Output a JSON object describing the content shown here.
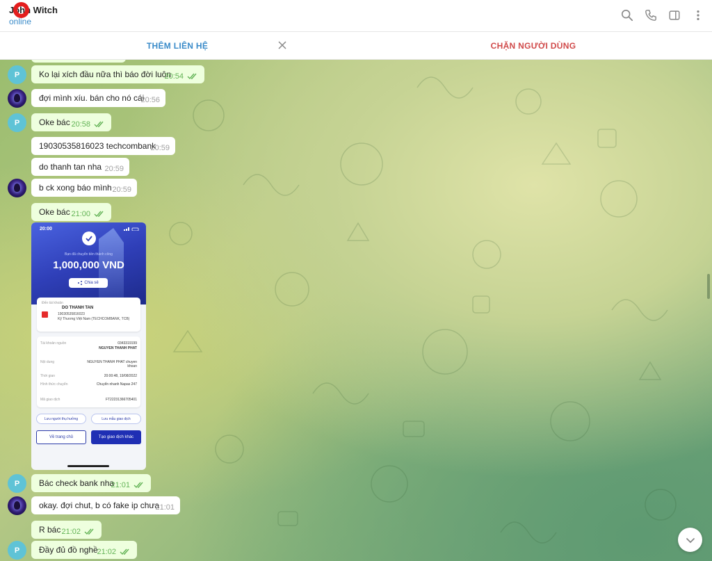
{
  "header": {
    "name": "John Witch",
    "status": "online",
    "icons": [
      "search-icon",
      "phone-icon",
      "sidebar-icon",
      "more-vertical-icon"
    ]
  },
  "actions": {
    "add_contact": "THÊM LIÊN HỆ",
    "block_user": "CHẶN NGƯỜI DÙNG"
  },
  "avatars": {
    "p_initial": "P"
  },
  "messages": [
    {
      "text": "Ko lại xích đầu nữa thì báo đời luôn",
      "time": "20:54"
    },
    {
      "text": "đợi mình xíu. bán cho nó cái",
      "time": "20:56"
    },
    {
      "text": "Oke bác",
      "time": "20:58"
    },
    {
      "text": "19030535816023 techcombank",
      "time": "20:59"
    },
    {
      "text": "do thanh tan nha",
      "time": "20:59"
    },
    {
      "text": "b ck xong báo mình",
      "time": "20:59"
    },
    {
      "text": "Oke bác",
      "time": "21:00"
    },
    {
      "text": "Bác check bank nha",
      "time": "21:01"
    },
    {
      "text": "okay. đợi chut, b có fake ip chưa",
      "time": "21:01"
    },
    {
      "text": "R bác",
      "time": "21:02"
    },
    {
      "text": "Đầy đủ đồ nghề",
      "time": "21:02"
    }
  ],
  "receipt": {
    "clock": "20:00",
    "subtitle": "Bạn đã chuyển tiền thành công",
    "amount": "1,000,000 VND",
    "share": "Chia sẻ",
    "to_account_label": "Đến tài khoản",
    "recipient_name": "DO THANH TAN",
    "recipient_account": "19030535816023",
    "recipient_bank": "Kỹ Thương Việt Nam (TECHCOMBANK, TCB)",
    "source_label": "Tài khoản nguồn",
    "source_account": "0343319199",
    "source_name": "NGUYEN THANH PHAT",
    "content_label": "Nội dung",
    "content_value": "NGUYEN THANH PHAT chuyen khoan",
    "time_label": "Thời gian",
    "time_value": "20:00:48, 19/08/2022",
    "method_label": "Hình thức chuyển",
    "method_value": "Chuyển nhanh Napas 247",
    "txn_label": "Mã giao dịch",
    "txn_value": "FT22231366705401",
    "save_beneficiary": "Lưu người thụ hưởng",
    "save_template": "Lưu mẫu giao dịch",
    "home_button": "Về trang chủ",
    "new_txn_button": "Tạo giao dịch khác"
  }
}
